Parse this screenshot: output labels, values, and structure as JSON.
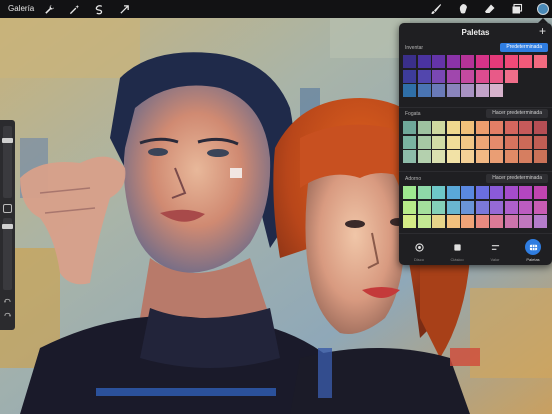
{
  "toolbar": {
    "gallery_label": "Galería",
    "left_icons": [
      "wrench-icon",
      "magic-wand-icon",
      "selection-icon",
      "transform-arrow-icon"
    ],
    "right_icons": [
      "brush-icon",
      "smudge-icon",
      "eraser-icon",
      "layers-icon"
    ],
    "current_color": "#4a8ab8"
  },
  "panel": {
    "title": "Paletas",
    "add_label": "+",
    "palettes": [
      {
        "name": "Inventar",
        "button_label": "Predeterminada",
        "is_default": true,
        "rows": [
          [
            "#3a2f8a",
            "#4a33a0",
            "#6434a8",
            "#8a33a8",
            "#b53398",
            "#d63388",
            "#e53a7a",
            "#f04a78",
            "#f25a7a",
            "#f26a80"
          ],
          [
            "#3d3c9a",
            "#5246ad",
            "#7a48b4",
            "#a047ad",
            "#c44aa0",
            "#dc4c90",
            "#e85a88",
            "#ef6e8a",
            "",
            ""
          ],
          [
            "#2f6fa8",
            "#4a74b2",
            "#6a7ab8",
            "#8a84bc",
            "#a892c2",
            "#c2a2c8",
            "#d6b2cc",
            "",
            "",
            ""
          ]
        ]
      },
      {
        "name": "Fogata",
        "button_label": "Hacer predeterminada",
        "is_default": false,
        "rows": [
          [
            "#6fa89a",
            "#9ec2a0",
            "#cfd9a0",
            "#efd88e",
            "#f2c07a",
            "#ee9e6e",
            "#e37e66",
            "#d4665e",
            "#c65a5a",
            "#b54e54"
          ],
          [
            "#7ab4a2",
            "#a6c8a4",
            "#d2dca6",
            "#f0dc98",
            "#f2c686",
            "#eea676",
            "#e48a6c",
            "#d8745e",
            "#cc6a58",
            "#c05e54"
          ],
          [
            "#8ebcaa",
            "#b4d0ae",
            "#dae0b0",
            "#f2e2a6",
            "#f4d096",
            "#f2b884",
            "#ea9e74",
            "#e08a66",
            "#d67e60",
            "#ca7258"
          ]
        ]
      },
      {
        "name": "Adorno",
        "button_label": "Hacer predeterminada",
        "is_default": false,
        "rows": [
          [
            "#9ee890",
            "#8ed8a8",
            "#6ec8c8",
            "#5aa8d8",
            "#5a88e0",
            "#6a6ee0",
            "#8a5ad8",
            "#a44ccc",
            "#b446c0",
            "#c044b0"
          ],
          [
            "#b8ec8a",
            "#a4e09c",
            "#84d0b8",
            "#6ab6d0",
            "#6a94d8",
            "#7a78da",
            "#966ad6",
            "#ae60cc",
            "#bc5cc0",
            "#c85cb4"
          ],
          [
            "#d4ec86",
            "#c2e892",
            "#e6d48a",
            "#f2c07e",
            "#f0a478",
            "#e88a80",
            "#dc7a96",
            "#cc74ac",
            "#c078be",
            "#b47cca"
          ]
        ]
      }
    ],
    "tabs": [
      {
        "label": "Disco",
        "icon": "disc-icon",
        "active": false
      },
      {
        "label": "Clásico",
        "icon": "square-icon",
        "active": false
      },
      {
        "label": "Valor",
        "icon": "sliders-icon",
        "active": false
      },
      {
        "label": "Paletas",
        "icon": "palette-grid-icon",
        "active": true
      }
    ]
  },
  "sidebar": {
    "icons": [
      "brush-size-slider",
      "modify-button-icon",
      "opacity-slider",
      "undo-icon",
      "redo-icon"
    ]
  }
}
